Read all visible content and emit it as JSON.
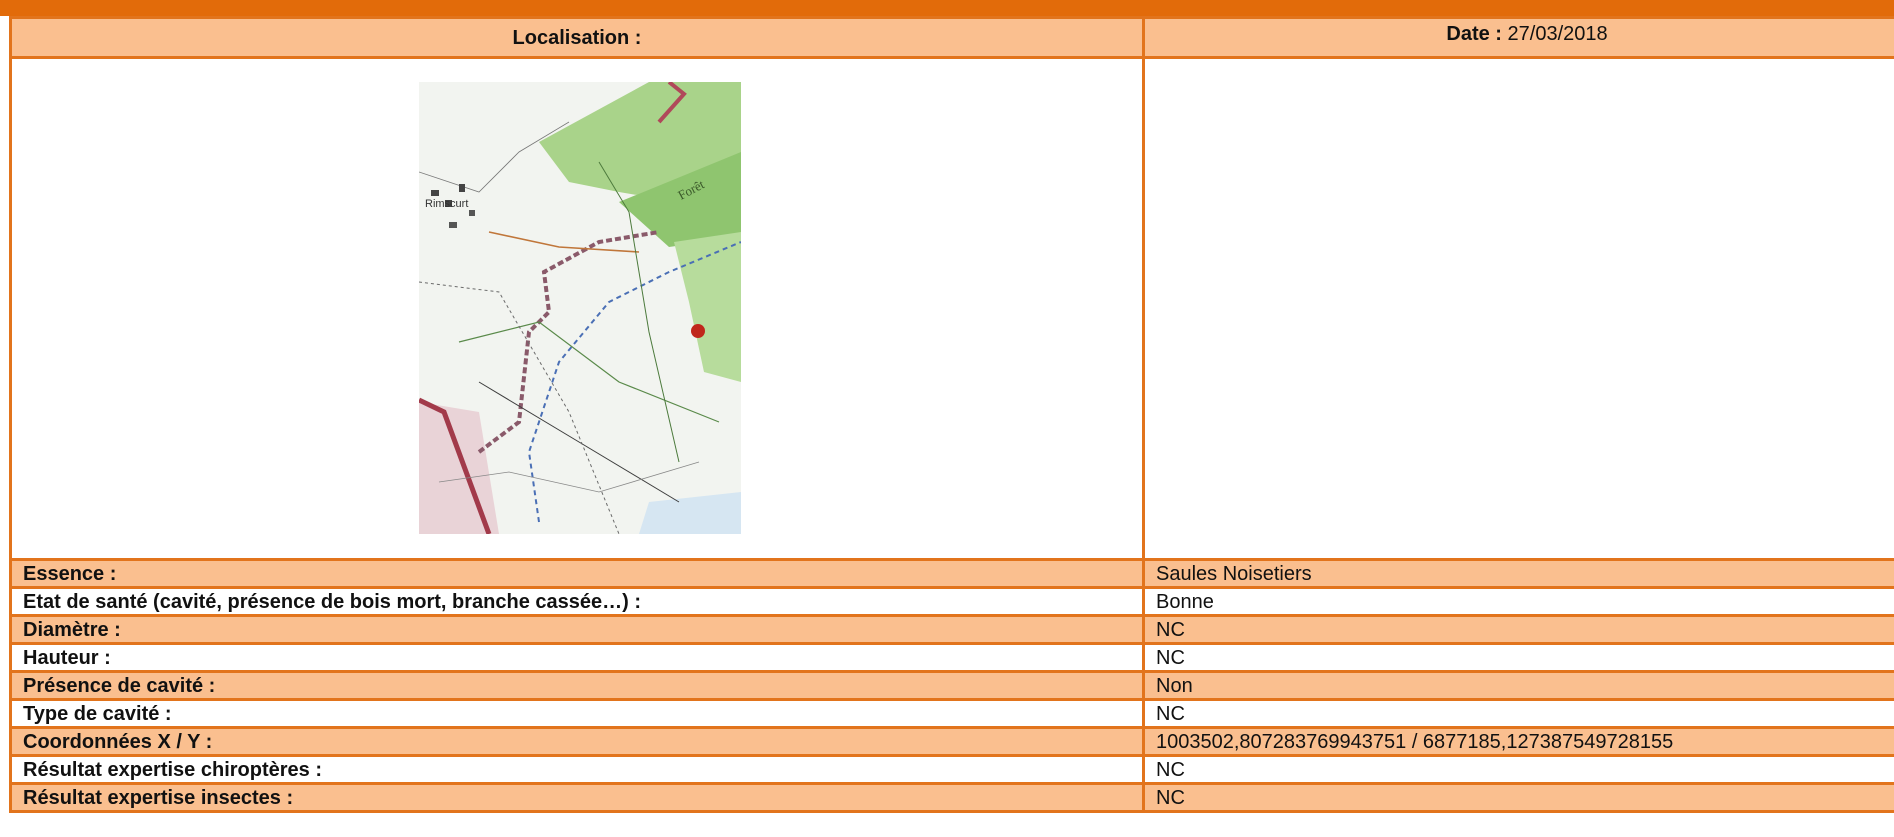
{
  "header": {
    "localisation_label": "Localisation :",
    "date_label": "Date :",
    "date_value": "27/03/2018"
  },
  "map": {
    "icon": "map-location-icon",
    "place_labels": [
      "Rimscurt",
      "Forêt"
    ],
    "marker_color": "#c0271b"
  },
  "rows": [
    {
      "label": "Essence :",
      "value": "Saules Noisetiers"
    },
    {
      "label": "Etat de santé (cavité, présence de bois mort, branche cassée…) :",
      "value": "Bonne"
    },
    {
      "label": "Diamètre :",
      "value": "NC"
    },
    {
      "label": "Hauteur :",
      "value": "NC"
    },
    {
      "label": "Présence de cavité :",
      "value": "Non"
    },
    {
      "label": "Type de cavité :",
      "value": "NC"
    },
    {
      "label": "Coordonnées X / Y :",
      "value": "1003502,807283769943751 / 6877185,127387549728155"
    },
    {
      "label": "Résultat expertise chiroptères :",
      "value": "NC"
    },
    {
      "label": "Résultat expertise insectes :",
      "value": "NC"
    }
  ],
  "colors": {
    "accent": "#e26b0a",
    "header_fill": "#fabf8f",
    "border": "#e2741c"
  }
}
